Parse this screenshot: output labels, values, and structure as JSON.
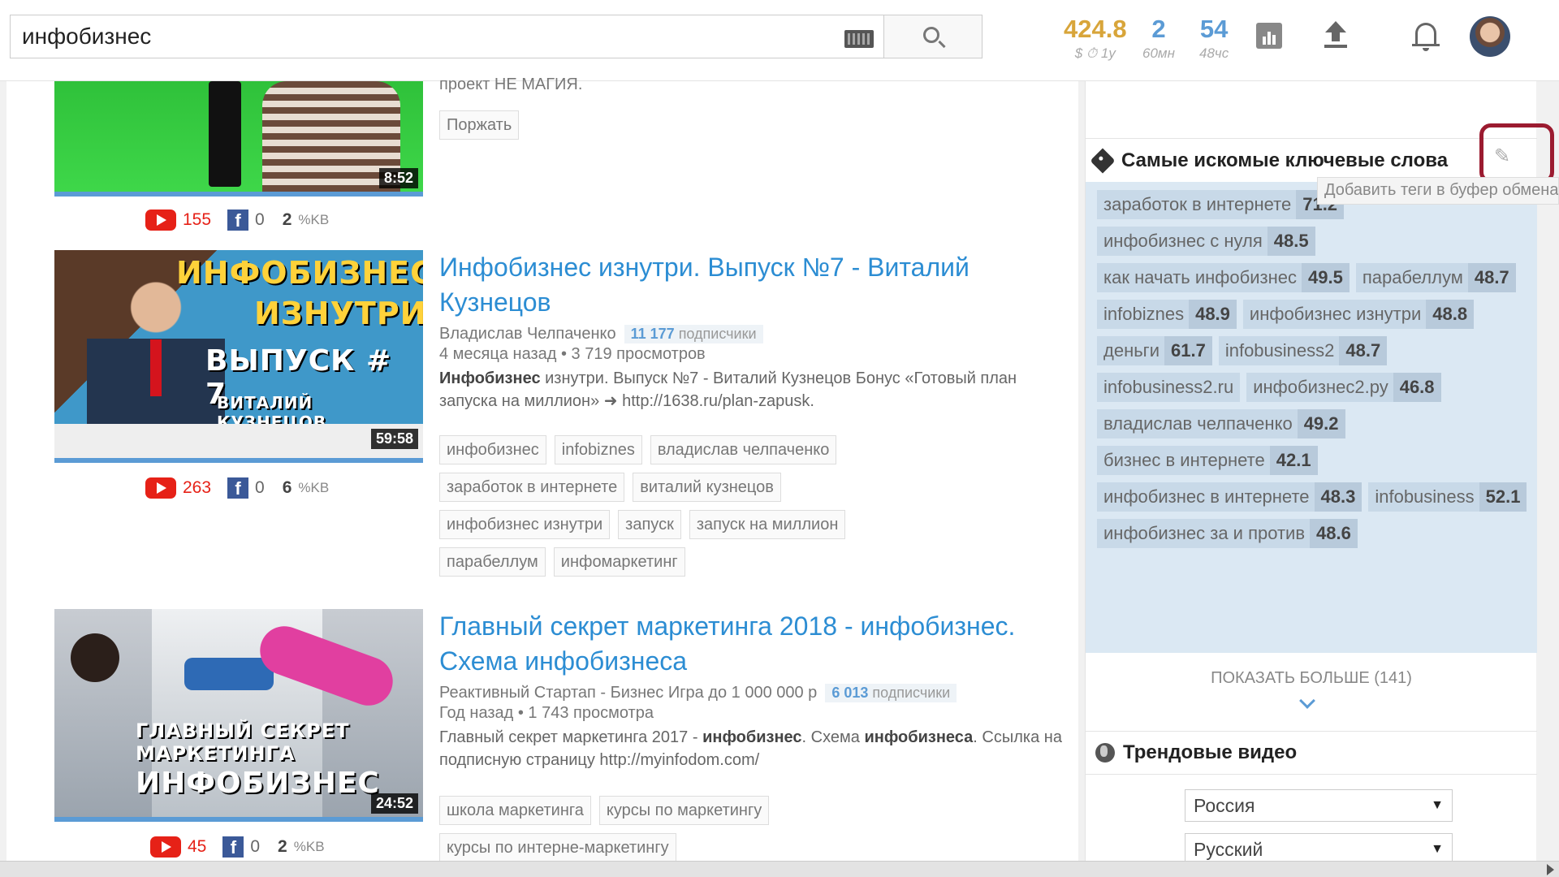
{
  "search": {
    "value": "инфобизнес"
  },
  "stats": [
    {
      "value": "424.8",
      "label": "$ ⏱ 1у"
    },
    {
      "value": "2",
      "label": "60мн"
    },
    {
      "value": "54",
      "label": "48чс"
    }
  ],
  "videos": [
    {
      "top_snippet": "проект НЕ МАГИЯ.",
      "duration": "8:52",
      "yt_count": "155",
      "fb_count": "0",
      "kw_count": "2",
      "kw_label": "%KB",
      "tags": [
        "Поржать"
      ]
    },
    {
      "title": "Инфобизнес изнутри. Выпуск №7 - Виталий Кузнецов",
      "channel": "Владислав Челпаченко",
      "subs_num": "11 177",
      "subs_label": "подписчики",
      "meta": "4 месяца назад • 3 719 просмотров",
      "desc_bold": "Инфобизнес",
      "desc": " изнутри. Выпуск №7 - Виталий Кузнецов Бонус «Готовый план запуска на миллион» ➜ http://1638.ru/plan-zapusk.",
      "thumb_line1": "ИНФОБИЗНЕС",
      "thumb_line2": "ИЗНУТРИ",
      "thumb_line3": "ВЫПУСК # 7",
      "thumb_line4": "ВИТАЛИЙ КУЗНЕЦОВ",
      "duration": "59:58",
      "yt_count": "263",
      "fb_count": "0",
      "kw_count": "6",
      "kw_label": "%KB",
      "tags": [
        "инфобизнес",
        "infobiznes",
        "владислав челпаченко",
        "заработок в интернете",
        "виталий кузнецов",
        "инфобизнес изнутри",
        "запуск",
        "запуск на миллион",
        "парабеллум",
        "инфомаркетинг"
      ]
    },
    {
      "title": "Главный секрет маркетинга 2018 - инфобизнес. Схема инфобизнеса",
      "channel": "Реактивный Стартап - Бизнес Игра до 1 000 000 р",
      "subs_num": "6 013",
      "subs_label": "подписчики",
      "meta": "Год назад • 1 743 просмотра",
      "desc_a": "Главный секрет маркетинга 2017 - ",
      "desc_b": "инфобизнес",
      "desc_c": ". Схема ",
      "desc_d": "инфобизнеса",
      "desc_e": ". Ссылка на подписную страницу http://myinfodom.com/",
      "thumb_line1": "ГЛАВНЫЙ СЕКРЕТ",
      "thumb_line2": "МАРКЕТИНГА",
      "thumb_line3": "ИНФОБИЗНЕС",
      "duration": "24:52",
      "yt_count": "45",
      "fb_count": "0",
      "kw_count": "2",
      "kw_label": "%KB",
      "tags": [
        "школа маркетинга",
        "курсы по маркетингу",
        "курсы по интерне-маркетингу"
      ]
    }
  ],
  "sidebar": {
    "keywords_title": "Самые искомые ключевые слова",
    "copy_tooltip": "Добавить теги в буфер обмена",
    "keywords": [
      {
        "text": "заработок в интернете",
        "score": "71.2"
      },
      {
        "text": "инфобизнес с нуля",
        "score": "48.5"
      },
      {
        "text": "как начать инфобизнес",
        "score": "49.5"
      },
      {
        "text": "парабеллум",
        "score": "48.7"
      },
      {
        "text": "infobiznes",
        "score": "48.9"
      },
      {
        "text": "инфобизнес изнутри",
        "score": "48.8"
      },
      {
        "text": "деньги",
        "score": "61.7"
      },
      {
        "text": "infobusiness2",
        "score": "48.7"
      },
      {
        "text": "infobusiness2.ru",
        "score": ""
      },
      {
        "text": "инфобизнес2.ру",
        "score": "46.8"
      },
      {
        "text": "владислав челпаченко",
        "score": "49.2"
      },
      {
        "text": "бизнес в интернете",
        "score": "42.1"
      },
      {
        "text": "инфобизнес в интернете",
        "score": "48.3"
      },
      {
        "text": "infobusiness",
        "score": "52.1"
      },
      {
        "text": "инфобизнес за и против",
        "score": "48.6"
      }
    ],
    "show_more": "ПОКАЗАТЬ БОЛЬШЕ (141)",
    "trending_title": "Трендовые видео",
    "country_select": "Россия",
    "language_select": "Русский"
  },
  "colors": {
    "accent": "#2c8dd3",
    "gold": "#d8a53a",
    "youtube": "#e62117",
    "facebook": "#3b5998",
    "highlight": "#9b1b30"
  }
}
